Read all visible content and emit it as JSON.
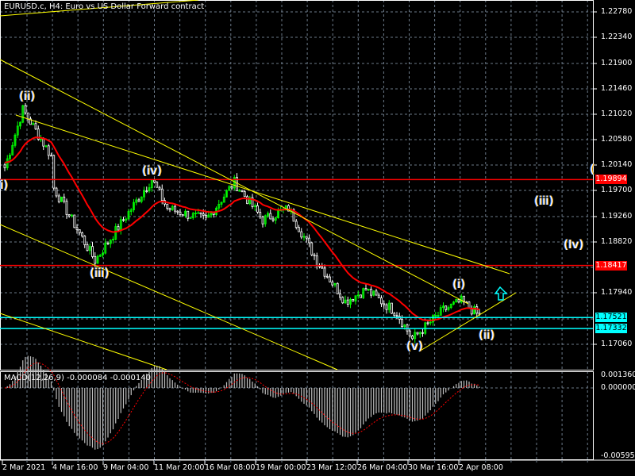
{
  "title": "EURUSD.c, H4:  Euro vs US Dollar Forward contract",
  "colors": {
    "bull": "#00ff00",
    "bear": "#ffffff",
    "ma": "#ff0000",
    "trend": "#ffff00",
    "support": "#00ffff",
    "resist": "#ff0000",
    "grid": "#6c7a89",
    "hist": "#c0c0c0"
  },
  "chart_data": {
    "type": "candlestick",
    "symbol": "EURUSD.c",
    "timeframe": "H4",
    "ylim": [
      1.168,
      1.23
    ],
    "price_ticks": [
      "1.22780",
      "1.22340",
      "1.21900",
      "1.21460",
      "1.21020",
      "1.20580",
      "1.20140",
      "1.19700",
      "1.19260",
      "1.18820",
      "1.17940",
      "1.17060"
    ],
    "time_ticks": [
      "2 Mar 2021",
      "4 Mar 16:00",
      "9 Mar 04:00",
      "11 Mar 20:00",
      "16 Mar 08:00",
      "19 Mar 00:00",
      "23 Mar 12:00",
      "26 Mar 04:00",
      "30 Mar 16:00",
      "2 Apr 08:00"
    ],
    "bars": 185,
    "close_path": [
      [
        0,
        1.201
      ],
      [
        7,
        1.211
      ],
      [
        18,
        1.203
      ],
      [
        19,
        1.1975
      ],
      [
        35,
        1.185
      ],
      [
        57,
        1.199
      ],
      [
        63,
        1.194
      ],
      [
        78,
        1.192
      ],
      [
        89,
        1.1985
      ],
      [
        100,
        1.192
      ],
      [
        110,
        1.194
      ],
      [
        121,
        1.185
      ],
      [
        132,
        1.178
      ],
      [
        140,
        1.18
      ],
      [
        152,
        1.176
      ],
      [
        158,
        1.1715
      ],
      [
        170,
        1.1765
      ],
      [
        177,
        1.178
      ],
      [
        184,
        1.1755
      ]
    ],
    "levels": [
      {
        "price": 1.19894,
        "label": "1.19894",
        "kind": "resist"
      },
      {
        "price": 1.18417,
        "label": "1.18417",
        "kind": "resist"
      },
      {
        "price": 1.17521,
        "label": "1.17521",
        "kind": "support"
      },
      {
        "price": 1.17332,
        "label": "1.17332",
        "kind": "support"
      }
    ],
    "wave_labels": [
      "(ii)",
      "i)",
      "(iv)",
      "(iii)",
      "(i)",
      "(v)",
      "(ii)",
      "(iii)",
      "(Iv)",
      "("
    ],
    "macd": {
      "label": "MACD(12,26,9) -0.000084 -0.000140",
      "ticks": [
        "0.001360",
        "0.000000",
        "-0.005950"
      ],
      "ylim": [
        -0.00595,
        0.00136
      ]
    }
  }
}
